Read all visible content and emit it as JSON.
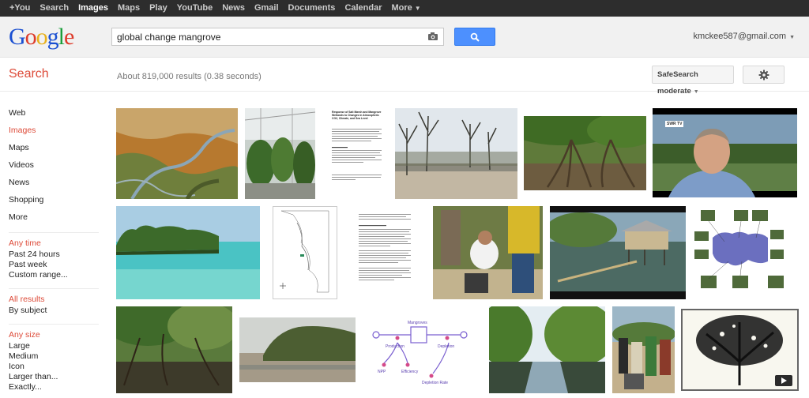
{
  "topnav": [
    {
      "label": "+You",
      "active": false
    },
    {
      "label": "Search",
      "active": false
    },
    {
      "label": "Images",
      "active": true
    },
    {
      "label": "Maps",
      "active": false
    },
    {
      "label": "Play",
      "active": false
    },
    {
      "label": "YouTube",
      "active": false
    },
    {
      "label": "News",
      "active": false
    },
    {
      "label": "Gmail",
      "active": false
    },
    {
      "label": "Documents",
      "active": false
    },
    {
      "label": "Calendar",
      "active": false
    },
    {
      "label": "More",
      "active": false
    }
  ],
  "header": {
    "logo": "Google",
    "query": "global change mangrove",
    "account": "kmckee587@gmail.com"
  },
  "subbar": {
    "title": "Search",
    "stats": "About 819,000 results (0.38 seconds)",
    "safesearch": "SafeSearch moderate"
  },
  "leftnav": {
    "items": [
      "Web",
      "Images",
      "Maps",
      "Videos",
      "News",
      "Shopping",
      "More"
    ],
    "time_title": "Any time",
    "time_options": [
      "Past 24 hours",
      "Past week",
      "Custom range..."
    ],
    "results_title": "All results",
    "results_options": [
      "By subject"
    ],
    "size_title": "Any size",
    "size_options": [
      "Large",
      "Medium",
      "Icon",
      "Larger than...",
      "Exactly..."
    ]
  },
  "thumbnails": {
    "paper_title": "Response of Salt Marsh and Mangrove Wetlands to Changes in Atmospheric CO2, Climate, and Sea Level",
    "video_badge": "SWR TV",
    "diagram_labels": [
      "Mangroves",
      "Production",
      "Depletion",
      "NPP",
      "Efficiency",
      "Depletion Rate"
    ]
  },
  "colors": {
    "accent_red": "#dd4b39",
    "search_blue": "#4d90fe",
    "topbar": "#2d2d2d"
  }
}
